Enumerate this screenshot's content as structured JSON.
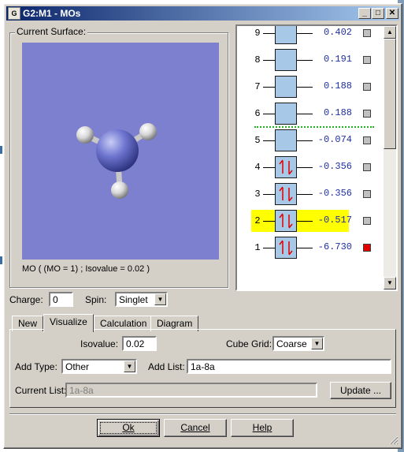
{
  "window": {
    "title": "G2:M1 - MOs",
    "icon_label": "G",
    "controls": {
      "minimize": "_",
      "maximize": "□",
      "close": "✕"
    }
  },
  "surface": {
    "group_label": "Current Surface:",
    "status": "MO ( (MO = 1) ; Isovalue = 0.02 )"
  },
  "orbitals": [
    {
      "index": "9",
      "energy": "0.402",
      "occupied": false,
      "highlighted": false,
      "checked": false
    },
    {
      "index": "8",
      "energy": "0.191",
      "occupied": false,
      "highlighted": false,
      "checked": false
    },
    {
      "index": "7",
      "energy": "0.188",
      "occupied": false,
      "highlighted": false,
      "checked": false
    },
    {
      "index": "6",
      "energy": "0.188",
      "occupied": false,
      "highlighted": false,
      "checked": false
    },
    {
      "index": "5",
      "energy": "-0.074",
      "occupied": false,
      "highlighted": false,
      "checked": false
    },
    {
      "index": "4",
      "energy": "-0.356",
      "occupied": true,
      "highlighted": false,
      "checked": false
    },
    {
      "index": "3",
      "energy": "-0.356",
      "occupied": true,
      "highlighted": false,
      "checked": false
    },
    {
      "index": "2",
      "energy": "-0.517",
      "occupied": true,
      "highlighted": true,
      "checked": false
    },
    {
      "index": "1",
      "energy": "-6.730",
      "occupied": true,
      "highlighted": false,
      "checked": true
    }
  ],
  "charge": {
    "label": "Charge:",
    "value": "0"
  },
  "spin": {
    "label": "Spin:",
    "value": "Singlet"
  },
  "tabs": [
    {
      "label": "New",
      "active": false
    },
    {
      "label": "Visualize",
      "active": true
    },
    {
      "label": "Calculation",
      "active": false
    },
    {
      "label": "Diagram",
      "active": false
    }
  ],
  "visualize": {
    "isovalue_label": "Isovalue:",
    "isovalue": "0.02",
    "cube_grid_label": "Cube Grid:",
    "cube_grid": "Coarse",
    "add_type_label": "Add Type:",
    "add_type": "Other",
    "add_list_label": "Add List:",
    "add_list": "1a-8a",
    "current_list_label": "Current List:",
    "current_list": "1a-8a",
    "update_label": "Update ..."
  },
  "buttons": {
    "ok": "Ok",
    "cancel": "Cancel",
    "help": "Help"
  },
  "colors": {
    "viewport_bg": "#7d80cf",
    "orbital_box": "#a8c8e8",
    "energy_text": "#2030a0",
    "highlight": "#ffff00",
    "checked": "#e00000",
    "homo_lumo_separator": "#20b020"
  }
}
